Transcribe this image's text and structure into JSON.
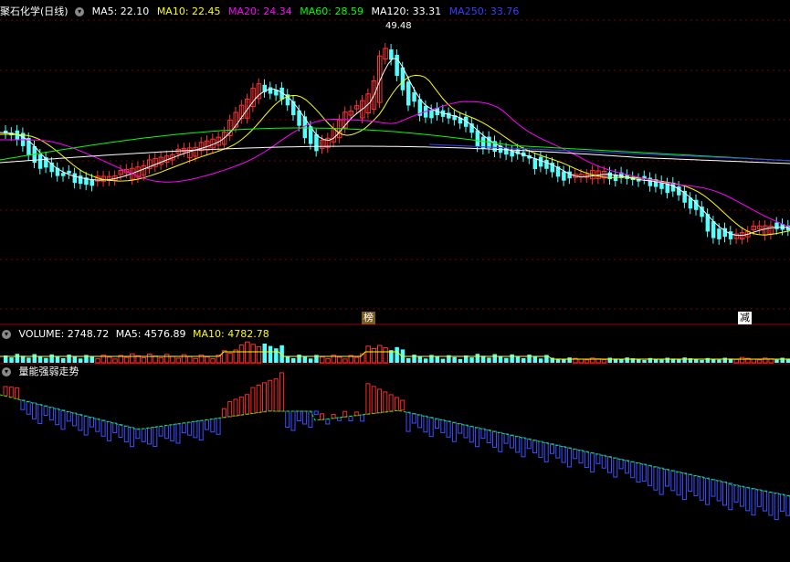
{
  "header_price": {
    "stock": "聚石化学(日线)",
    "ma5": "MA5: 22.10",
    "ma10": "MA10: 22.45",
    "ma20": "MA20: 24.34",
    "ma60": "MA60: 28.59",
    "ma120": "MA120: 33.31",
    "ma250": "MA250: 33.76"
  },
  "header_volume": {
    "volume": "VOLUME: 2748.72",
    "ma5": "MA5: 4576.89",
    "ma10": "MA10: 4782.78"
  },
  "header_indicator": {
    "name": "量能强弱走势"
  },
  "peak_label": "49.48",
  "markers": {
    "bang": "榜",
    "jian": "减"
  },
  "colors": {
    "background": "#000000",
    "up": "#ff3232",
    "down": "#54ffff",
    "ma5": "#ffffff",
    "ma10": "#ffff00",
    "ma20": "#ff00ff",
    "ma60": "#00ff00",
    "ma120": "#ffffff",
    "ma250": "#3c3cff",
    "grid": "#7a0000",
    "indicator_down": "#3c50ff",
    "indicator_up": "#ff2828"
  }
}
